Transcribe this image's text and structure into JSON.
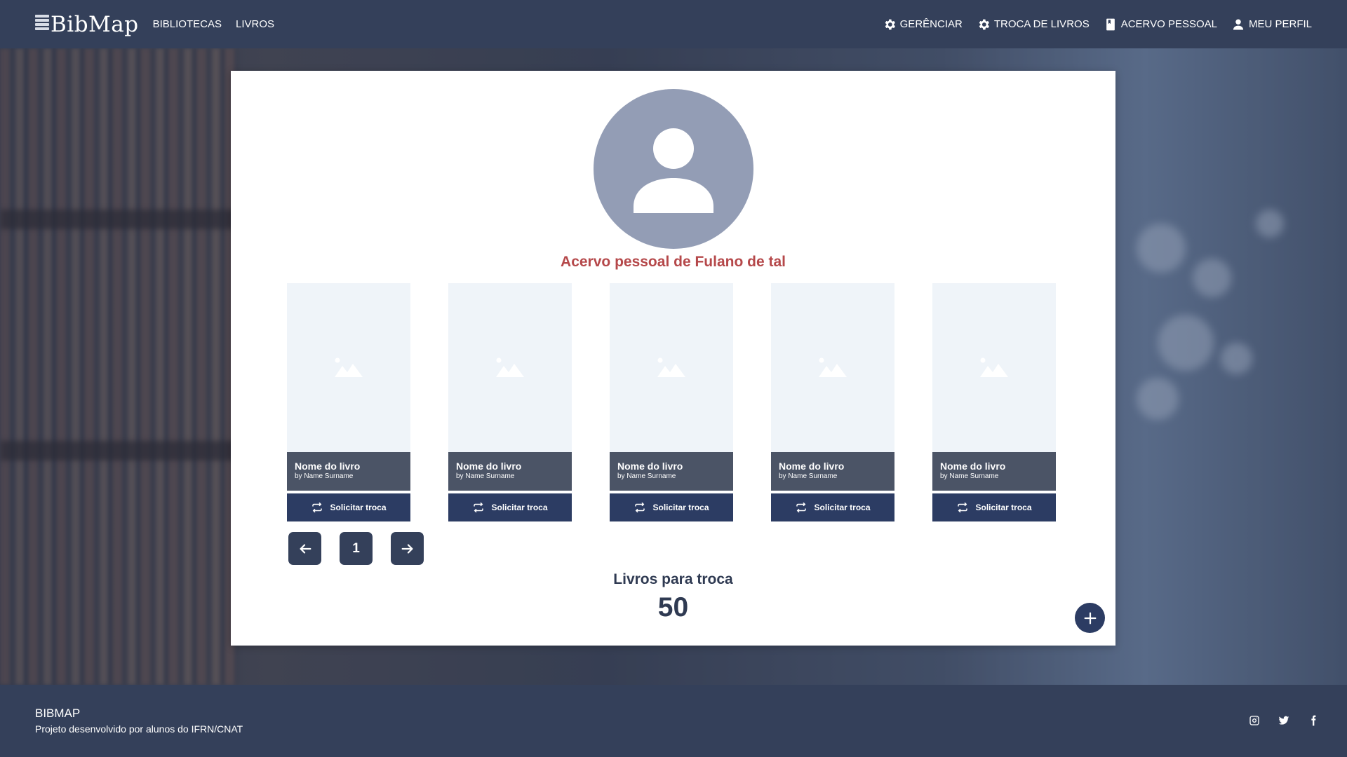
{
  "header": {
    "logo": "BibMap",
    "nav_left": [
      "BIBLIOTECAS",
      "LIVROS"
    ],
    "nav_right": [
      {
        "label": "GERÊNCIAR",
        "icon": "gear-icon"
      },
      {
        "label": "TROCA DE LIVROS",
        "icon": "gear-icon"
      },
      {
        "label": "ACERVO PESSOAL",
        "icon": "book-icon"
      },
      {
        "label": "MEU PERFIL",
        "icon": "user-icon"
      }
    ]
  },
  "profile": {
    "title": "Acervo pessoal de Fulano de tal",
    "avatar_icon": "user-avatar-icon"
  },
  "books": [
    {
      "name": "Nome do livro",
      "author": "by Name Surname",
      "button": "Solicitar troca"
    },
    {
      "name": "Nome do livro",
      "author": "by Name Surname",
      "button": "Solicitar troca"
    },
    {
      "name": "Nome do livro",
      "author": "by Name Surname",
      "button": "Solicitar troca"
    },
    {
      "name": "Nome do livro",
      "author": "by Name Surname",
      "button": "Solicitar troca"
    },
    {
      "name": "Nome do livro",
      "author": "by Name Surname",
      "button": "Solicitar troca"
    }
  ],
  "pagination": {
    "current_page": "1"
  },
  "stats": {
    "label": "Livros para troca",
    "value": "50"
  },
  "footer": {
    "brand": "BIBMAP",
    "description": "Projeto desenvolvido por alunos do IFRN/CNAT",
    "socials": [
      "instagram-icon",
      "twitter-icon",
      "facebook-icon"
    ]
  },
  "colors": {
    "header_bg": "#34405a",
    "accent_title": "#b5484a",
    "button_bg": "#2c3c63",
    "book_info_bg": "#4b5466",
    "avatar_bg": "#939db5"
  }
}
